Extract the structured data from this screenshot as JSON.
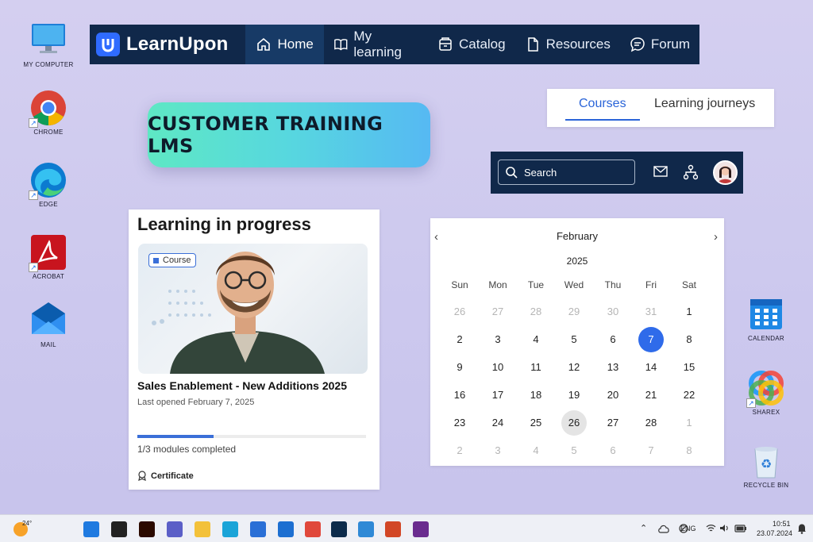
{
  "desktop": {
    "left_icons": [
      {
        "label": "MY COMPUTER",
        "icon": "monitor-icon"
      },
      {
        "label": "CHROME",
        "icon": "chrome-icon"
      },
      {
        "label": "EDGE",
        "icon": "edge-icon"
      },
      {
        "label": "ACROBAT",
        "icon": "acrobat-icon"
      },
      {
        "label": "MAIL",
        "icon": "mail-icon"
      }
    ],
    "right_icons": [
      {
        "label": "CALENDAR",
        "icon": "calendar-icon"
      },
      {
        "label": "SHAREX",
        "icon": "sharex-icon"
      },
      {
        "label": "RECYCLE BIN",
        "icon": "recycle-bin-icon"
      }
    ]
  },
  "nav": {
    "brand": "LearnUpon",
    "items": [
      {
        "label": "Home",
        "icon": "home-icon",
        "active": true
      },
      {
        "label": "My learning",
        "icon": "book-icon",
        "active": false
      },
      {
        "label": "Catalog",
        "icon": "catalog-icon",
        "active": false
      },
      {
        "label": "Resources",
        "icon": "document-icon",
        "active": false
      },
      {
        "label": "Forum",
        "icon": "chat-icon",
        "active": false
      }
    ],
    "colors": {
      "bg": "#10284a",
      "active_bg": "#173a66",
      "brand": "#2f6bff"
    }
  },
  "banner": {
    "text": "CUSTOMER TRAINING LMS"
  },
  "tabs": {
    "items": [
      "Courses",
      "Learning journeys"
    ],
    "active": "Courses"
  },
  "searchbar": {
    "placeholder": "Search",
    "icons": [
      "mail-icon",
      "hierarchy-icon",
      "avatar"
    ]
  },
  "learning": {
    "title": "Learning in progress",
    "badge": "Course",
    "course_name": "Sales Enablement - New Additions 2025",
    "last_opened": "Last opened February 7, 2025",
    "progress": 0.333,
    "modules_text": "1/3 modules completed",
    "certificate": "Certificate"
  },
  "calendar": {
    "month": "February",
    "year": "2025",
    "weekdays": [
      "Sun",
      "Mon",
      "Tue",
      "Wed",
      "Thu",
      "Fri",
      "Sat"
    ],
    "weeks": [
      [
        {
          "d": "26",
          "m": true
        },
        {
          "d": "27",
          "m": true
        },
        {
          "d": "28",
          "m": true
        },
        {
          "d": "29",
          "m": true
        },
        {
          "d": "30",
          "m": true
        },
        {
          "d": "31",
          "m": true
        },
        {
          "d": "1"
        }
      ],
      [
        {
          "d": "2"
        },
        {
          "d": "3"
        },
        {
          "d": "4"
        },
        {
          "d": "5"
        },
        {
          "d": "6"
        },
        {
          "d": "7",
          "s": true
        },
        {
          "d": "8"
        }
      ],
      [
        {
          "d": "9"
        },
        {
          "d": "10"
        },
        {
          "d": "11"
        },
        {
          "d": "12"
        },
        {
          "d": "13"
        },
        {
          "d": "14"
        },
        {
          "d": "15"
        }
      ],
      [
        {
          "d": "16"
        },
        {
          "d": "17"
        },
        {
          "d": "18"
        },
        {
          "d": "19"
        },
        {
          "d": "20"
        },
        {
          "d": "21"
        },
        {
          "d": "22"
        }
      ],
      [
        {
          "d": "23"
        },
        {
          "d": "24"
        },
        {
          "d": "25"
        },
        {
          "d": "26",
          "t": true
        },
        {
          "d": "27"
        },
        {
          "d": "28"
        },
        {
          "d": "1",
          "m": true
        }
      ],
      [
        {
          "d": "2",
          "m": true
        },
        {
          "d": "3",
          "m": true
        },
        {
          "d": "4",
          "m": true
        },
        {
          "d": "5",
          "m": true
        },
        {
          "d": "6",
          "m": true
        },
        {
          "d": "7",
          "m": true
        },
        {
          "d": "8",
          "m": true
        }
      ]
    ]
  },
  "taskbar": {
    "weather": "24°",
    "apps": [
      "windows-start-icon",
      "task-view-icon",
      "illustrator-icon",
      "teams-icon",
      "file-explorer-icon",
      "edge-icon",
      "store-icon",
      "mail-icon",
      "chrome-icon",
      "photoshop-icon",
      "photos-icon",
      "powerpoint-icon",
      "winrar-icon"
    ],
    "lang": "ENG",
    "time": "10:51",
    "date": "23.07.2024"
  }
}
